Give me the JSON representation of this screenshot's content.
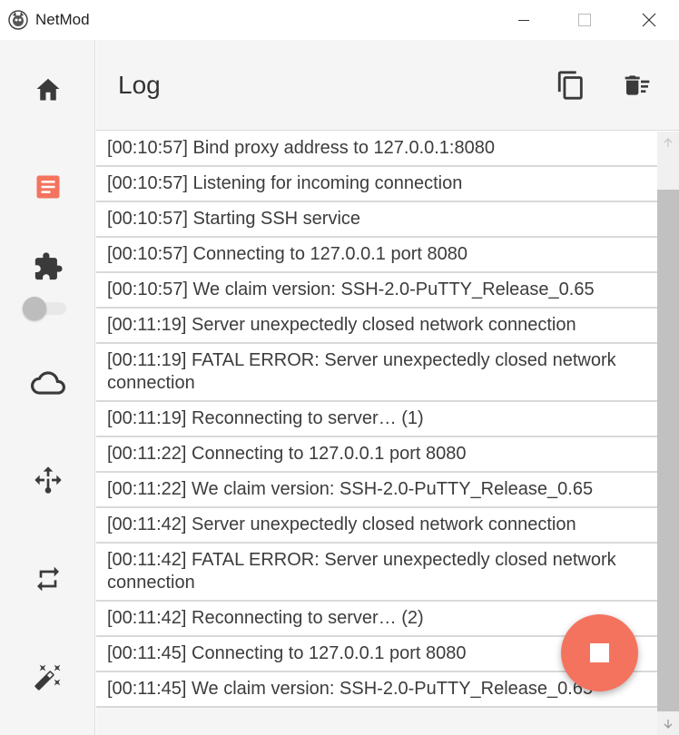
{
  "window": {
    "title": "NetMod",
    "controls": [
      "minimize",
      "maximize",
      "close"
    ]
  },
  "sidebar": {
    "items": [
      {
        "id": "home",
        "icon": "home-icon"
      },
      {
        "id": "log",
        "icon": "document-icon",
        "active": true
      },
      {
        "id": "plugins",
        "icon": "puzzle-icon"
      },
      {
        "id": "cloud",
        "icon": "cloud-icon"
      },
      {
        "id": "network",
        "icon": "network-arrows-icon"
      },
      {
        "id": "sync",
        "icon": "repeat-icon"
      },
      {
        "id": "tools",
        "icon": "magic-wand-icon"
      }
    ],
    "toggle_on": false
  },
  "header": {
    "title": "Log",
    "actions": [
      {
        "id": "copy",
        "icon": "copy-icon"
      },
      {
        "id": "clear",
        "icon": "delete-sweep-icon"
      }
    ]
  },
  "log": {
    "entries": [
      "[00:10:57] Bind proxy address to 127.0.0.1:8080",
      "[00:10:57] Listening for incoming connection",
      "[00:10:57] Starting SSH service",
      "[00:10:57] Connecting to 127.0.0.1 port 8080",
      "[00:10:57] We claim version: SSH-2.0-PuTTY_Release_0.65",
      "[00:11:19] Server unexpectedly closed network connection",
      "[00:11:19] FATAL ERROR: Server unexpectedly closed network connection",
      "[00:11:19] Reconnecting to server… (1)",
      "[00:11:22] Connecting to 127.0.0.1 port 8080",
      "[00:11:22] We claim version: SSH-2.0-PuTTY_Release_0.65",
      "[00:11:42] Server unexpectedly closed network connection",
      "[00:11:42] FATAL ERROR: Server unexpectedly closed network connection",
      "[00:11:42] Reconnecting to server… (2)",
      "[00:11:45] Connecting to 127.0.0.1 port 8080",
      "[00:11:45] We claim version: SSH-2.0-PuTTY_Release_0.65"
    ]
  },
  "fab": {
    "icon": "stop-icon"
  },
  "colors": {
    "accent": "#f4735f",
    "icon": "#3a3a3a",
    "sidebar_bg": "#f5f5f5",
    "row_bg": "#ffffff",
    "divider": "#d9d9d9"
  }
}
